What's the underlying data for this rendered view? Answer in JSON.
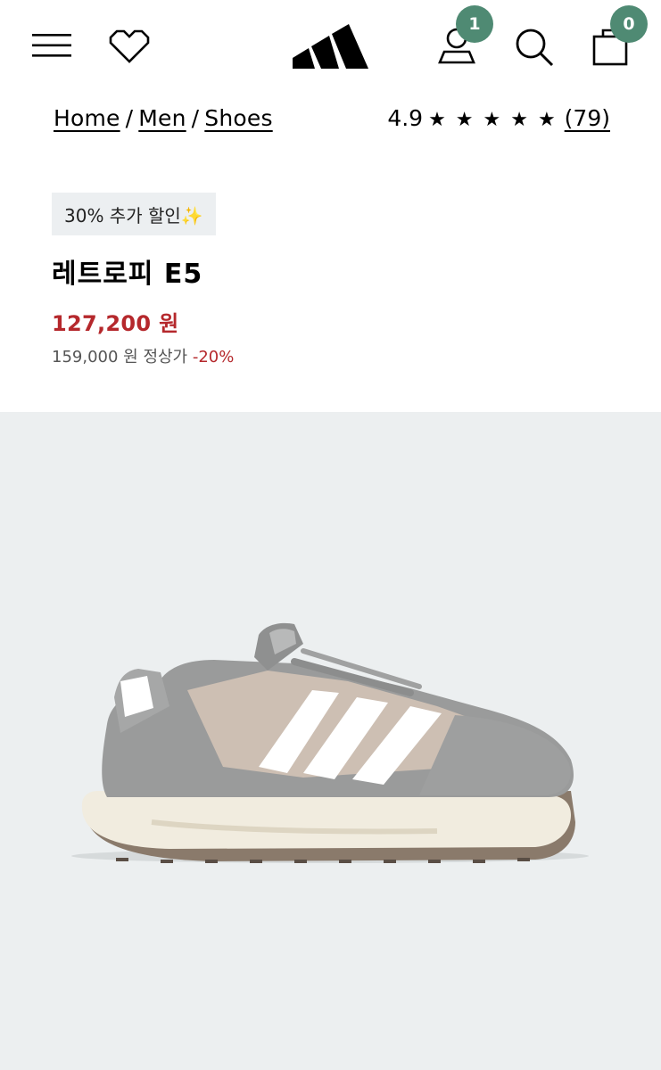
{
  "header": {
    "menu_icon": "hamburger-menu-icon",
    "wishlist_icon": "heart-icon",
    "logo": "adidas-logo",
    "account_icon": "user-icon",
    "account_badge": "1",
    "search_icon": "search-icon",
    "bag_icon": "shopping-bag-icon",
    "bag_badge": "0",
    "badge_color": "#4f8a73"
  },
  "breadcrumb": {
    "items": [
      "Home",
      "Men",
      "Shoes"
    ],
    "separator": "/"
  },
  "rating": {
    "score": "4.9",
    "stars": "★ ★ ★ ★ ★",
    "count": "(79)"
  },
  "product": {
    "promo_label": "30% 추가 할인✨",
    "name": "레트로피 E5",
    "sale_price": "127,200 원",
    "original_price": "159,000 원 정상가",
    "discount": "-20%",
    "sale_color": "#b5282c"
  },
  "gallery": {
    "image": "product-image-shoe"
  }
}
